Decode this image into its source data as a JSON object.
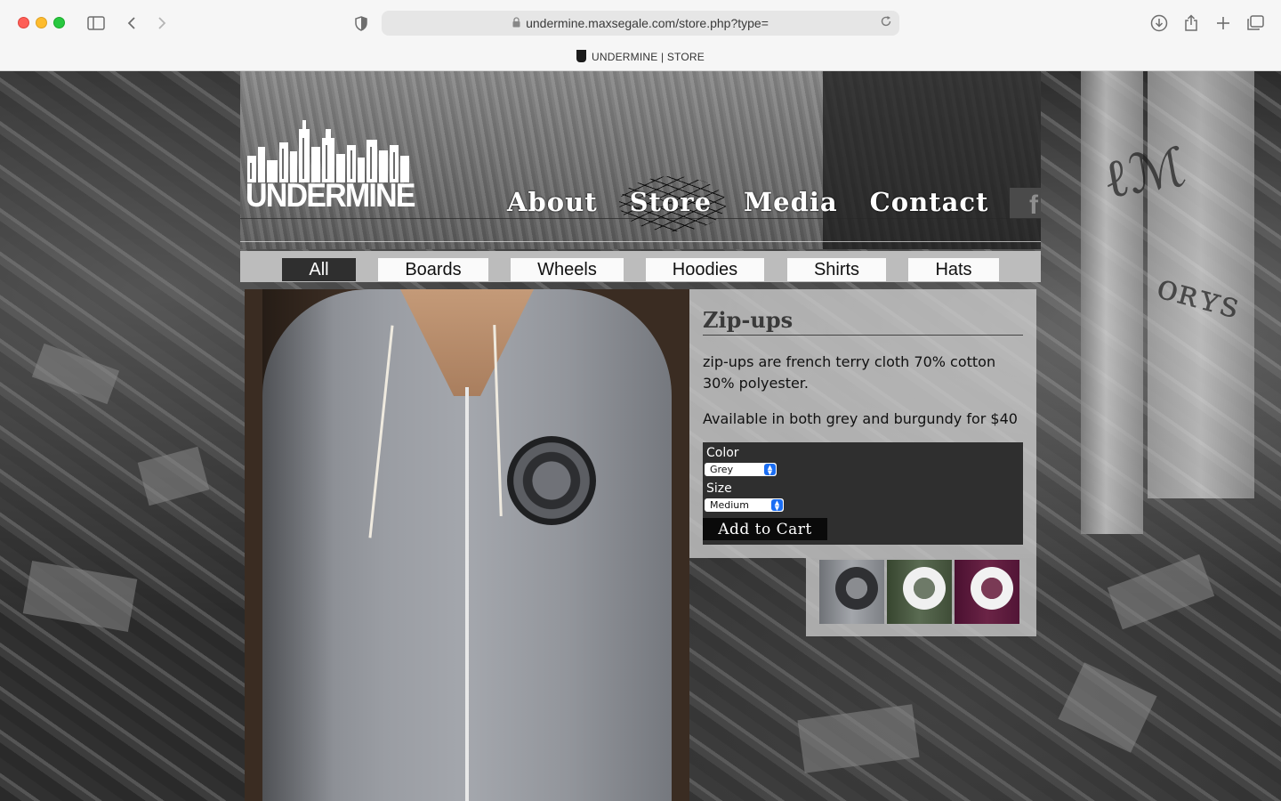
{
  "browser": {
    "url": "undermine.maxsegale.com/store.php?type=",
    "tab_title": "UNDERMINE | STORE"
  },
  "site": {
    "logo_text": "UNDERMINE",
    "nav": {
      "about": "About",
      "store": "Store",
      "media": "Media",
      "contact": "Contact"
    },
    "facebook_glyph": "f"
  },
  "categories": {
    "all": "All",
    "boards": "Boards",
    "wheels": "Wheels",
    "hoodies": "Hoodies",
    "shirts": "Shirts",
    "hats": "Hats",
    "active": "All"
  },
  "product": {
    "title": "Zip-ups",
    "description": "zip-ups are french terry cloth 70% cotton 30% polyester.",
    "availability": "Available in both grey and burgundy for $40",
    "color_label": "Color",
    "color_value": "Grey",
    "size_label": "Size",
    "size_value": "Medium",
    "add_to_cart": "Add to Cart",
    "thumbnails": [
      "grey",
      "green",
      "burgundy"
    ]
  },
  "colors": {
    "active_category_bg": "#2f2f2f",
    "form_bg": "#2f2f2f",
    "select_arrow": "#1b6ef3",
    "grey_hoodie": "#8c8f95",
    "green_hoodie": "#4a5a46",
    "burgundy_hoodie": "#5a1a35"
  }
}
